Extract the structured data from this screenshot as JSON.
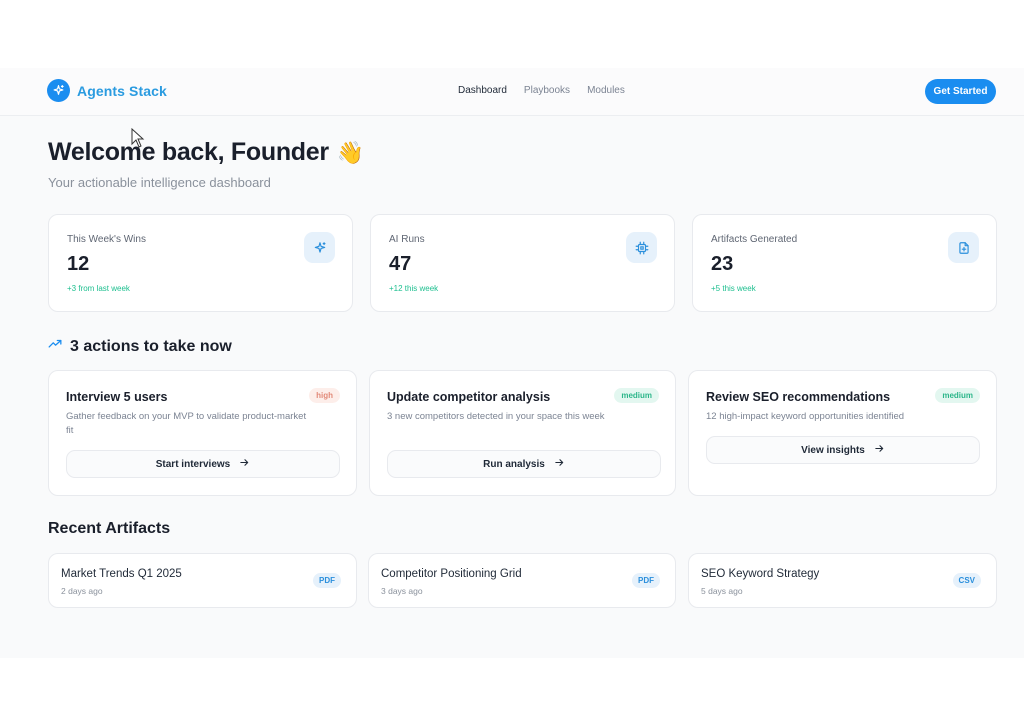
{
  "brand": {
    "name": "Agents Stack",
    "icon": "sparkle-icon"
  },
  "nav": {
    "items": [
      {
        "label": "Dashboard",
        "active": true
      },
      {
        "label": "Playbooks",
        "active": false
      },
      {
        "label": "Modules",
        "active": false
      }
    ],
    "cta_label": "Get Started"
  },
  "welcome": {
    "title": "Welcome back, Founder",
    "emoji": "👋",
    "subtitle": "Your actionable intelligence dashboard"
  },
  "stats": [
    {
      "label": "This Week's Wins",
      "value": "12",
      "delta": "+3 from last week",
      "icon": "sparkle-icon"
    },
    {
      "label": "AI Runs",
      "value": "47",
      "delta": "+12 this week",
      "icon": "cpu-icon"
    },
    {
      "label": "Artifacts Generated",
      "value": "23",
      "delta": "+5 this week",
      "icon": "file-plus-icon"
    }
  ],
  "actions": {
    "heading": "3 actions to take now",
    "items": [
      {
        "title": "Interview 5 users",
        "priority": "high",
        "description": "Gather feedback on your MVP to validate product-market fit",
        "button": "Start interviews"
      },
      {
        "title": "Update competitor analysis",
        "priority": "medium",
        "description": "3 new competitors detected in your space this week",
        "button": "Run analysis"
      },
      {
        "title": "Review SEO recommendations",
        "priority": "medium",
        "description": "12 high-impact keyword opportunities identified",
        "button": "View insights"
      }
    ]
  },
  "artifacts": {
    "heading": "Recent Artifacts",
    "items": [
      {
        "title": "Market Trends Q1 2025",
        "time": "2 days ago",
        "type": "PDF"
      },
      {
        "title": "Competitor Positioning Grid",
        "time": "3 days ago",
        "type": "PDF"
      },
      {
        "title": "SEO Keyword Strategy",
        "time": "5 days ago",
        "type": "CSV"
      }
    ]
  },
  "colors": {
    "accent": "#1a8df0",
    "positive": "#1dbf8f",
    "high": "#e28a79",
    "medium": "#2cb68a"
  }
}
